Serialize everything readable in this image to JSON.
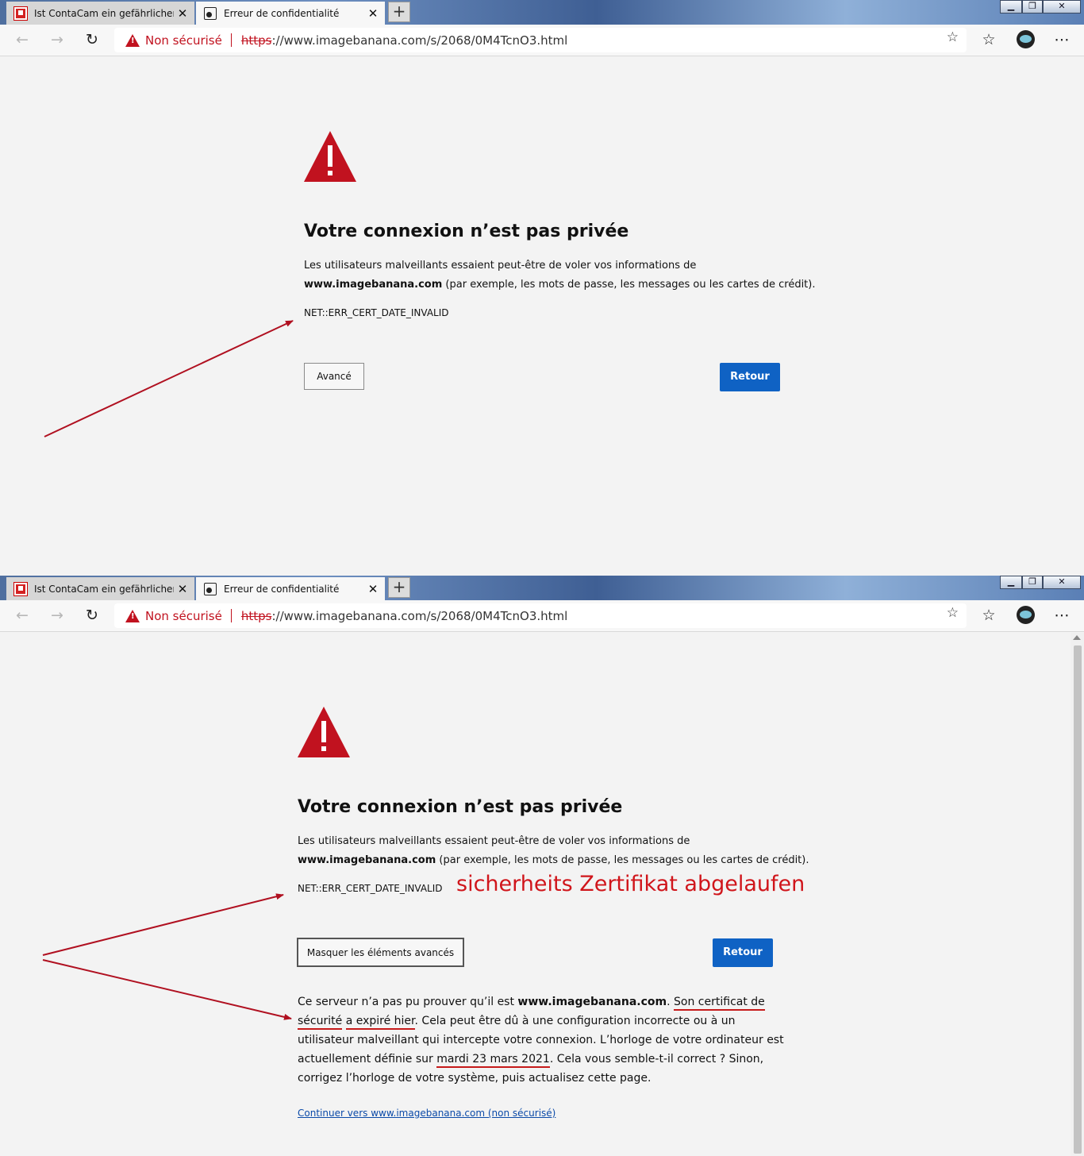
{
  "browser": {
    "tabs": [
      {
        "title": "Ist ContaCam ein gefährlicher Tr",
        "close": "✕"
      },
      {
        "title": "Erreur de confidentialité",
        "close": "✕"
      }
    ],
    "new_tab": "+",
    "window_buttons": {
      "minimize": "▁",
      "restore": "❐",
      "close": "✕"
    },
    "address_bar": {
      "security_label": "Non sécurisé",
      "scheme": "https",
      "rest": "://www.imagebanana.com/s/2068/0M4TcnO3.html"
    },
    "icons": {
      "back": "back-arrow-icon",
      "forward": "forward-arrow-icon",
      "refresh": "refresh-icon",
      "favorite": "star-add-icon",
      "favorites": "favorites-icon",
      "more": "more-icon"
    }
  },
  "page": {
    "heading": "Votre connexion n’est pas privée",
    "intro_line1": "Les utilisateurs malveillants essaient peut-être de voler vos informations de",
    "intro_domain": "www.imagebanana.com",
    "intro_line2_rest": " (par exemple, les mots de passe, les messages ou les cartes de crédit).",
    "error_code": "NET::ERR_CERT_DATE_INVALID",
    "advanced_button": "Avancé",
    "hide_advanced_button": "Masquer les éléments avancés",
    "back_button": "Retour",
    "annotation": "sicherheits Zertifikat abgelaufen",
    "detail": {
      "p1": "Ce serveur n’a pas pu prouver qu’il est ",
      "domain": "www.imagebanana.com",
      "p2": ". ",
      "u1": "Son certificat de sécurité",
      "u2": "a expiré hier",
      "p3": ". Cela peut être dû à une configuration incorrecte ou à un utilisateur malveillant qui intercepte votre connexion. L’horloge de votre ordinateur est actuellement définie sur ",
      "u3": "mardi 23 mars 2021",
      "p4": ". Cela vous semble-t-il correct ? Sinon, corrigez l’horloge de votre système, puis actualisez cette page."
    },
    "proceed_link": "Continuer vers www.imagebanana.com (non sécurisé)"
  },
  "colors": {
    "warning_red": "#c1121f",
    "annotation_red": "#d0151b",
    "primary_blue": "#0f62c4"
  }
}
